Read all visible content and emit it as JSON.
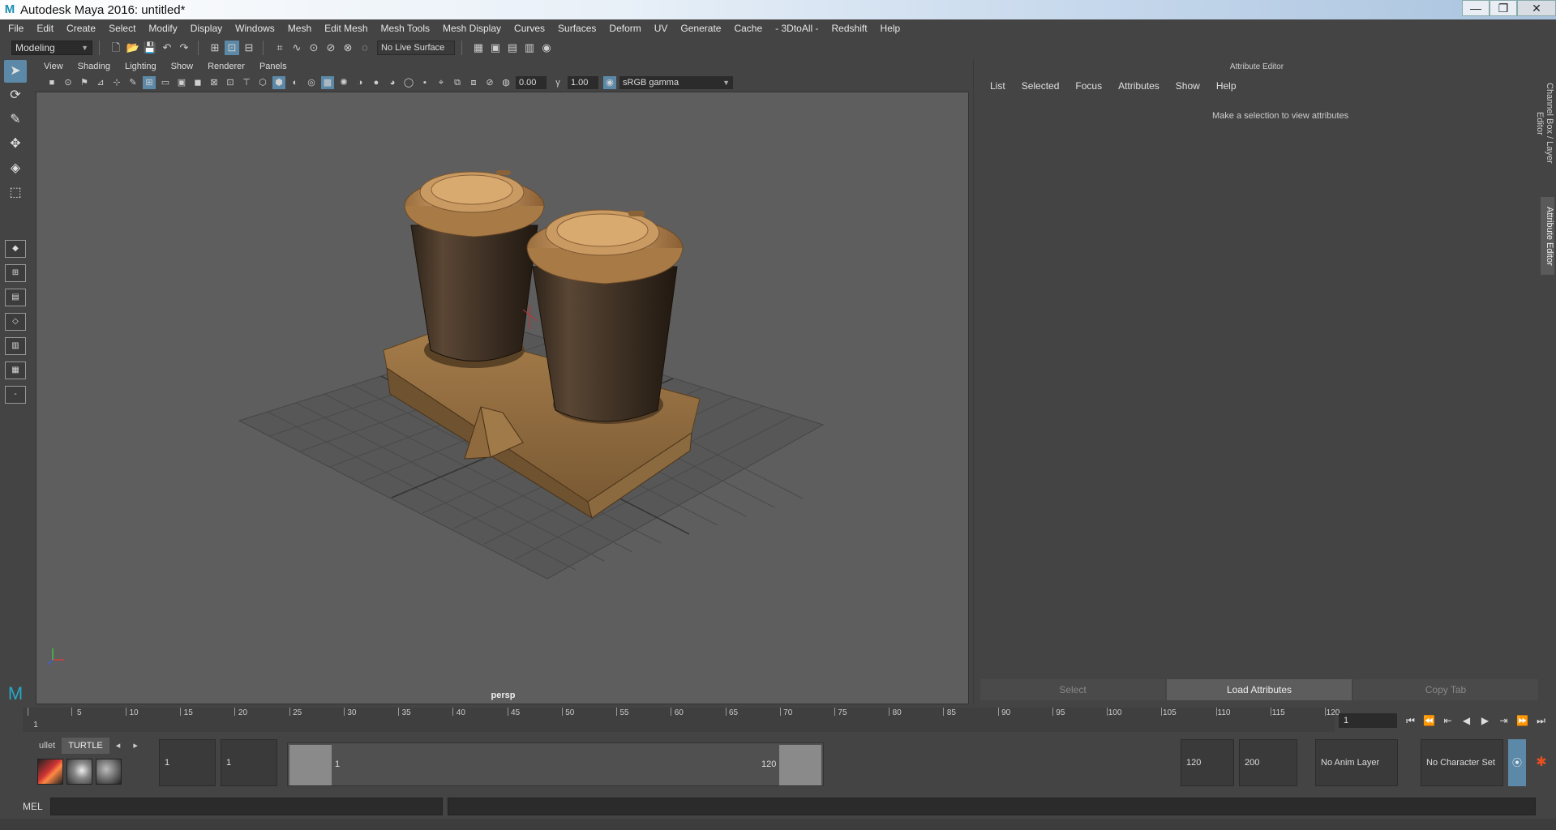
{
  "window": {
    "title": "Autodesk Maya 2016: untitled*",
    "minimize": "—",
    "maximize": "❐",
    "close": "✕"
  },
  "menus": [
    "File",
    "Edit",
    "Create",
    "Select",
    "Modify",
    "Display",
    "Windows",
    "Mesh",
    "Edit Mesh",
    "Mesh Tools",
    "Mesh Display",
    "Curves",
    "Surfaces",
    "Deform",
    "UV",
    "Generate",
    "Cache",
    "- 3DtoAll -",
    "Redshift",
    "Help"
  ],
  "statusline": {
    "mode": "Modeling",
    "live_surface": "No Live Surface"
  },
  "panel_menus": [
    "View",
    "Shading",
    "Lighting",
    "Show",
    "Renderer",
    "Panels"
  ],
  "panel_toolbar": {
    "exposure": "0.00",
    "gamma": "1.00",
    "color_space": "sRGB gamma"
  },
  "viewport": {
    "camera_label": "persp"
  },
  "attribute_editor": {
    "title": "Attribute Editor",
    "menus": [
      "List",
      "Selected",
      "Focus",
      "Attributes",
      "Show",
      "Help"
    ],
    "message": "Make a selection to view attributes",
    "footer_buttons": [
      "Select",
      "Load Attributes",
      "Copy Tab"
    ]
  },
  "side_tabs": {
    "channel_box": "Channel Box / Layer Editor",
    "attribute_editor": "Attribute Editor"
  },
  "timeline": {
    "ticks": [
      1,
      5,
      10,
      15,
      20,
      25,
      30,
      35,
      40,
      45,
      50,
      55,
      60,
      65,
      70,
      75,
      80,
      85,
      90,
      95,
      100,
      105,
      110,
      115,
      120
    ],
    "current_frame": "1",
    "playback_icons": [
      "⏮",
      "⏪",
      "⇤",
      "◀",
      "▶",
      "⇥",
      "⏩",
      "⏭"
    ]
  },
  "range": {
    "start_time": "1",
    "playback_start": "1",
    "range_start_label": "1",
    "range_end_label": "120",
    "playback_end": "120",
    "end_time": "200",
    "anim_layer": "No Anim Layer",
    "character_set": "No Character Set"
  },
  "shelf": {
    "tabs": [
      "ullet",
      "TURTLE"
    ]
  },
  "command_line": {
    "label": "MEL"
  },
  "colors": {
    "accent": "#5c89a8",
    "viewport_bg": "#5e5e5e",
    "cup": "#4a3a2c",
    "lid": "#b8874f",
    "tray": "#9a7446"
  }
}
